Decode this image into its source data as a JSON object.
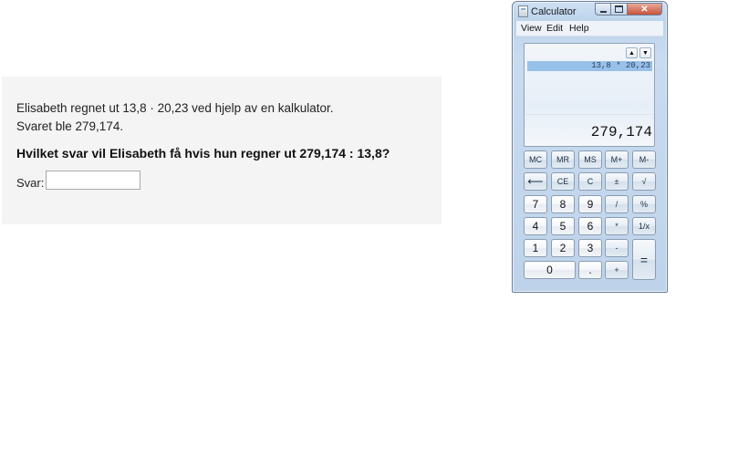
{
  "question": {
    "line1": "Elisabeth regnet ut 13,8 · 20,23 ved hjelp av en kalkulator.",
    "line2": "Svaret ble 279,174.",
    "prompt": "Hvilket svar vil Elisabeth få hvis hun regner ut 279,174 : 13,8?",
    "answer_label": "Svar:",
    "answer_value": ""
  },
  "calculator": {
    "title": "Calculator",
    "caption_close": "✕",
    "menu": [
      "View",
      "Edit",
      "Help"
    ],
    "history_up": "▲",
    "history_down": "▼",
    "expression": "13,8 * 20,23",
    "result": "279,174",
    "keys": {
      "mc": "MC",
      "mr": "MR",
      "ms": "MS",
      "mplus": "M+",
      "mminus": "M-",
      "back": "⟵",
      "ce": "CE",
      "c": "C",
      "plusminus": "±",
      "sqrt": "√",
      "k7": "7",
      "k8": "8",
      "k9": "9",
      "div": "/",
      "pct": "%",
      "k4": "4",
      "k5": "5",
      "k6": "6",
      "mul": "*",
      "recip": "1/x",
      "k1": "1",
      "k2": "2",
      "k3": "3",
      "sub": "-",
      "eq": "=",
      "k0": "0",
      "dot": ".",
      "add": "+"
    }
  }
}
